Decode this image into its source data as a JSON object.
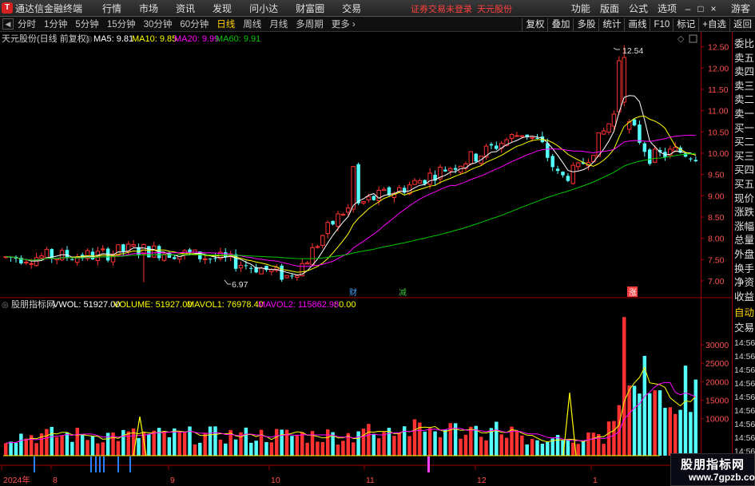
{
  "menubar": {
    "app_title": "通达信金融终端",
    "items": [
      "行情",
      "市场",
      "资讯",
      "发现",
      "问小达",
      "财富圈",
      "交易"
    ],
    "trade_status": "证券交易未登录",
    "stock_name": "天元股份",
    "right_items": [
      "功能",
      "版面",
      "公式",
      "选项"
    ],
    "user": "游客"
  },
  "periodbar": {
    "periods": [
      "分时",
      "1分钟",
      "5分钟",
      "15分钟",
      "30分钟",
      "60分钟",
      "日线",
      "周线",
      "月线",
      "多周期",
      "更多"
    ],
    "active_period": "日线",
    "tools": [
      "复权",
      "叠加",
      "多股",
      "统计",
      "画线",
      "F10",
      "标记",
      "+自选",
      "返回"
    ]
  },
  "kline_header": {
    "title": "天元股份(日线 前复权)",
    "ma5": "MA5: 9.81",
    "ma10": "MA10: 9.85",
    "ma20": "MA20: 9.99",
    "ma60": "MA60: 9.91"
  },
  "volume_header": {
    "title": "股朋指标网",
    "vwol": "VWOL: 51927.00",
    "volume": "VOLUME: 51927.00",
    "mavol1": "MAVOL1: 76978.40",
    "mavol2": "MAVOL2: 115862.98",
    "extra": ": 0.00"
  },
  "annotations": {
    "high": "12.54",
    "low": "6.97",
    "marker_cai": "财",
    "marker_jian": "减",
    "marker_zhang": "涨"
  },
  "price_axis": [
    "12.50",
    "12.00",
    "11.50",
    "11.00",
    "10.50",
    "10.00",
    "9.50",
    "9.00",
    "8.50",
    "8.00",
    "7.50",
    "7.00"
  ],
  "volume_axis": [
    "30000",
    "25000",
    "20000",
    "15000",
    "10000"
  ],
  "date_axis": [
    "2024年",
    "8",
    "9",
    "10",
    "11",
    "12",
    "1"
  ],
  "sidebar": {
    "items": [
      "委比",
      "卖五",
      "卖四",
      "卖三",
      "卖二",
      "卖一",
      "买一",
      "买二",
      "买三",
      "买四",
      "买五",
      "现价",
      "涨跌",
      "涨幅",
      "总量",
      "外盘",
      "换手",
      "净资",
      "收益"
    ],
    "tab_auto": "自动",
    "tab_trade": "交易",
    "time_label": "14:56"
  },
  "watermark": {
    "title": "股朋指标网",
    "url": "www.7gpzb.com"
  },
  "colors": {
    "up": "#ff3232",
    "down": "#54ffff",
    "ma5": "#ffffff",
    "ma10": "#ffff00",
    "ma20": "#ff00ff",
    "ma60": "#00c800",
    "axis": "#a00000"
  },
  "chart_data": {
    "type": "candlestick",
    "price_ylim": [
      6.85,
      12.7
    ],
    "volume_ylim": [
      0,
      38000
    ],
    "high": 12.54,
    "low": 6.97,
    "last_values": {
      "MA5": 9.81,
      "MA10": 9.85,
      "MA20": 9.99,
      "MA60": 9.91
    },
    "volume_last": {
      "VOLUME": 51927,
      "MAVOL1": 76978.4,
      "MAVOL2": 115862.98
    }
  }
}
